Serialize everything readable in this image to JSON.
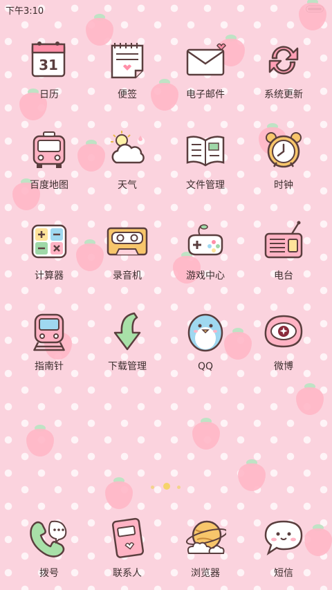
{
  "status": {
    "time": "下午3:10"
  },
  "apps": [
    {
      "label": "日历",
      "icon": "calendar-icon"
    },
    {
      "label": "便签",
      "icon": "notepad-icon"
    },
    {
      "label": "电子邮件",
      "icon": "mail-icon"
    },
    {
      "label": "系统更新",
      "icon": "refresh-icon"
    },
    {
      "label": "百度地图",
      "icon": "bus-icon"
    },
    {
      "label": "天气",
      "icon": "cloud-sun-icon"
    },
    {
      "label": "文件管理",
      "icon": "open-book-icon"
    },
    {
      "label": "时钟",
      "icon": "alarm-clock-icon"
    },
    {
      "label": "计算器",
      "icon": "calculator-icon"
    },
    {
      "label": "录音机",
      "icon": "cassette-icon"
    },
    {
      "label": "游戏中心",
      "icon": "gamepad-icon"
    },
    {
      "label": "电台",
      "icon": "radio-icon"
    },
    {
      "label": "指南针",
      "icon": "train-icon"
    },
    {
      "label": "下载管理",
      "icon": "down-arrow-icon"
    },
    {
      "label": "QQ",
      "icon": "penguin-icon"
    },
    {
      "label": "微博",
      "icon": "weibo-eye-icon"
    }
  ],
  "dock": [
    {
      "label": "拨号",
      "icon": "phone-icon"
    },
    {
      "label": "联系人",
      "icon": "contacts-book-icon"
    },
    {
      "label": "浏览器",
      "icon": "planet-icon"
    },
    {
      "label": "短信",
      "icon": "speech-bubble-icon"
    }
  ]
}
